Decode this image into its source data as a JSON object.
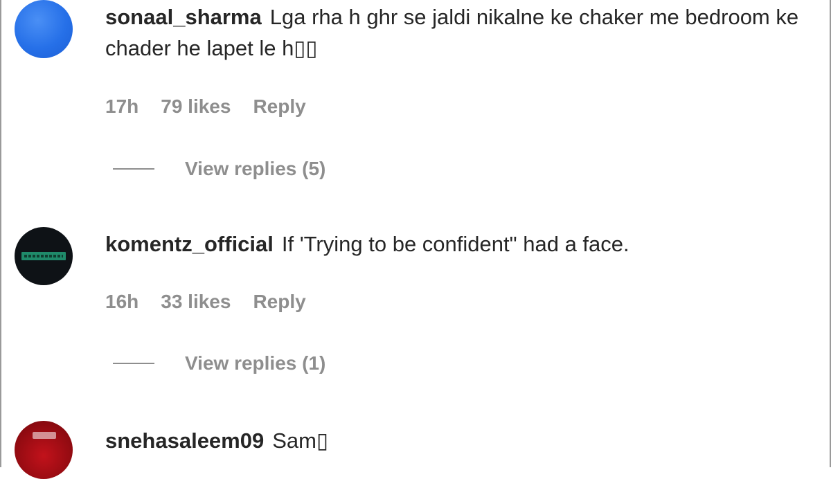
{
  "comments": [
    {
      "username": "sonaal_sharma",
      "text": "Lga rha h ghr se jaldi nikalne ke chaker me bedroom ke chader he lapet le h▯▯",
      "time": "17h",
      "likes": "79 likes",
      "reply": "Reply",
      "view_replies": "View replies (5)"
    },
    {
      "username": "komentz_official",
      "text": "If 'Trying to be confident\" had a face.",
      "time": "16h",
      "likes": "33 likes",
      "reply": "Reply",
      "view_replies": "View replies (1)"
    },
    {
      "username": "snehasaleem09",
      "text": "Sam▯"
    }
  ],
  "colors": {
    "text": "#262626",
    "meta": "#8e8e8e",
    "avatar_blue": "#2670e8",
    "avatar_dark": "#0e1216",
    "avatar_red": "#c2121b"
  },
  "icons": [
    "user-avatar-blue",
    "user-avatar-komentz-logo",
    "user-avatar-red"
  ]
}
